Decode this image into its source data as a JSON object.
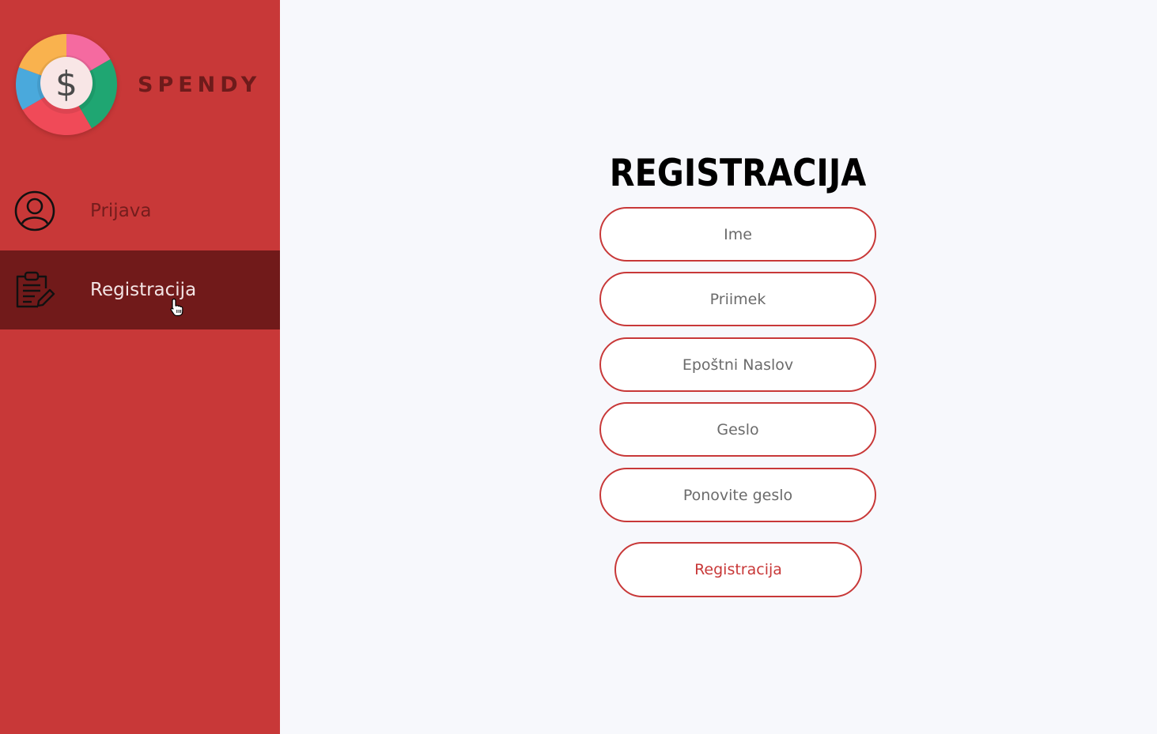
{
  "app": {
    "brand_name": "SPENDY",
    "logo_symbol": "$"
  },
  "colors": {
    "sidebar": "#c83838",
    "sidebar_active": "#711a1a",
    "background": "#f7f8fc",
    "accent": "#c83838",
    "logo_orange": "#f9b24e",
    "logo_pink": "#f56aa0",
    "logo_green": "#1fa672",
    "logo_red": "#f04a58",
    "logo_blue": "#4aa9dc"
  },
  "sidebar": {
    "items": [
      {
        "label": "Prijava",
        "icon": "user-circle-icon",
        "active": false
      },
      {
        "label": "Registracija",
        "icon": "clipboard-edit-icon",
        "active": true
      }
    ]
  },
  "form": {
    "title": "REGISTRACIJA",
    "fields": [
      {
        "placeholder": "Ime",
        "value": ""
      },
      {
        "placeholder": "Priimek",
        "value": ""
      },
      {
        "placeholder": "Epoštni Naslov",
        "value": ""
      },
      {
        "placeholder": "Geslo",
        "value": ""
      },
      {
        "placeholder": "Ponovite geslo",
        "value": ""
      }
    ],
    "submit_label": "Registracija"
  }
}
